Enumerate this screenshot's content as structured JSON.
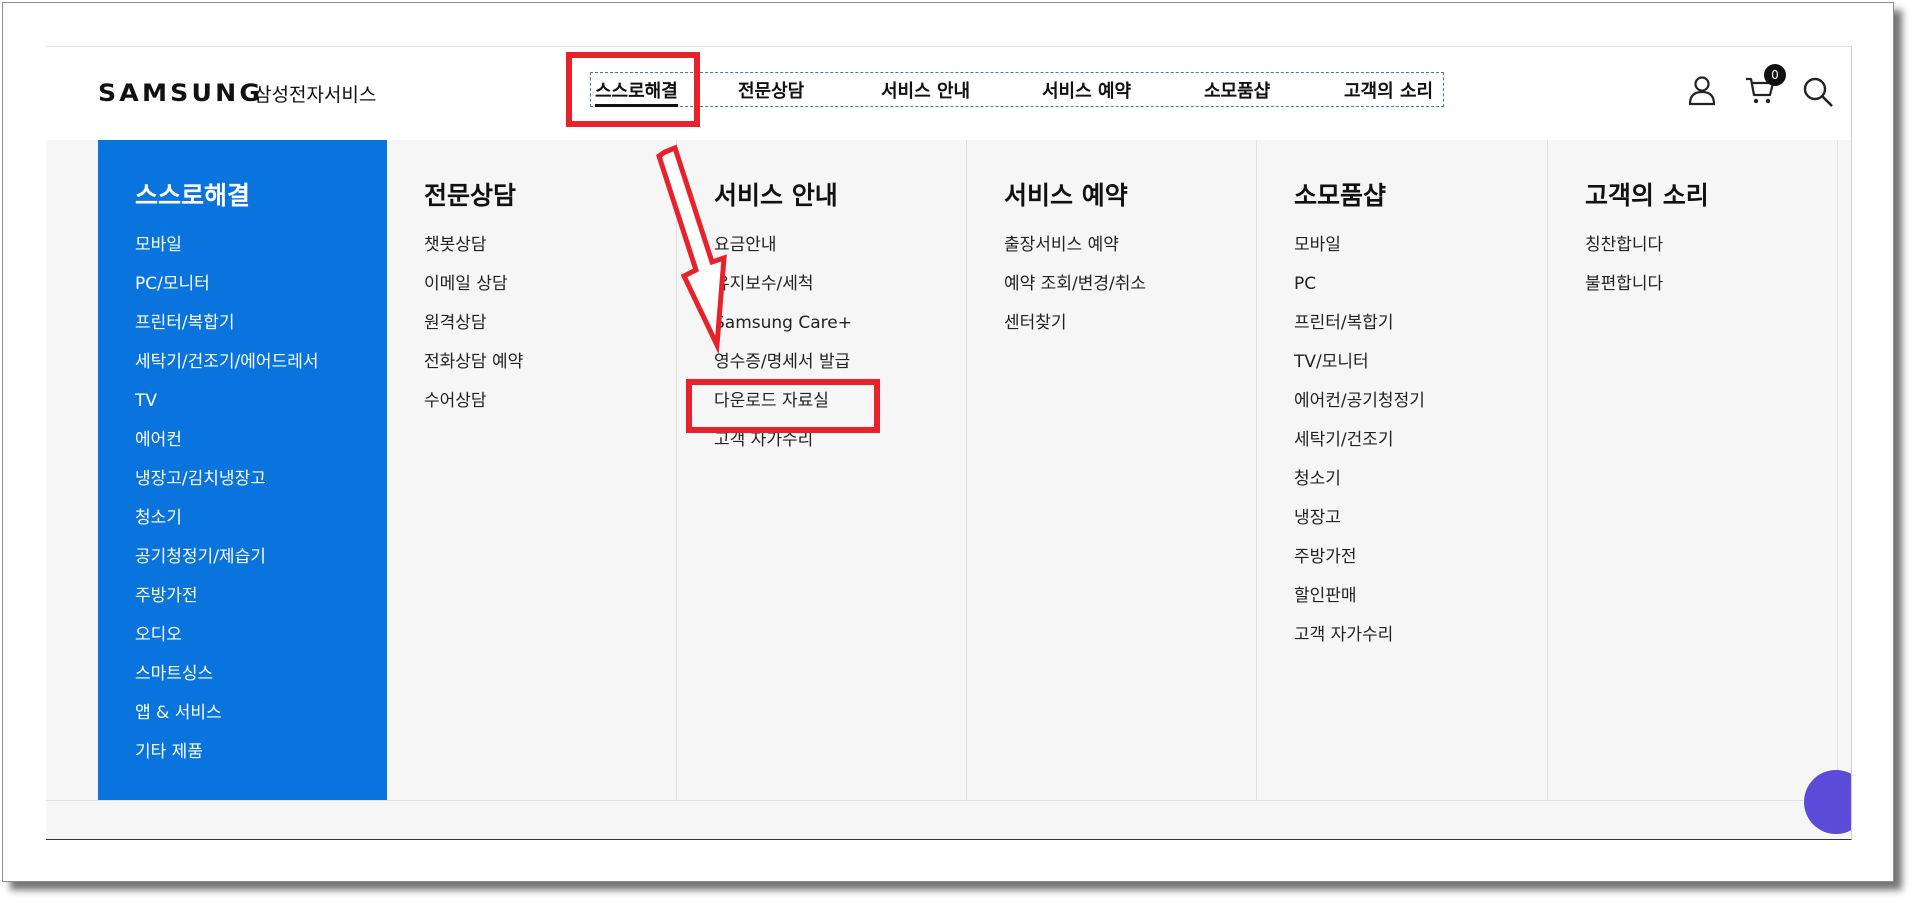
{
  "brand": {
    "logo": "SAMSUNG",
    "subtitle": "삼성전자서비스"
  },
  "nav": {
    "items": [
      {
        "label": "스스로해결"
      },
      {
        "label": "전문상담"
      },
      {
        "label": "서비스 안내"
      },
      {
        "label": "서비스 예약"
      },
      {
        "label": "소모품샵"
      },
      {
        "label": "고객의 소리"
      }
    ],
    "active": "스스로해결"
  },
  "cart": {
    "count": "0"
  },
  "icons": {
    "user": "user-icon",
    "cart": "cart-icon",
    "search": "search-icon"
  },
  "menu": {
    "self_solve": {
      "title": "스스로해결",
      "items": [
        "모바일",
        "PC/모니터",
        "프린터/복합기",
        "세탁기/건조기/에어드레서",
        "TV",
        "에어컨",
        "냉장고/김치냉장고",
        "청소기",
        "공기청정기/제습기",
        "주방가전",
        "오디오",
        "스마트싱스",
        "앱 & 서비스",
        "기타 제품"
      ]
    },
    "consult": {
      "title": "전문상담",
      "items": [
        "챗봇상담",
        "이메일 상담",
        "원격상담",
        "전화상담 예약",
        "수어상담"
      ]
    },
    "service_info": {
      "title": "서비스 안내",
      "items": [
        "요금안내",
        "유지보수/세척",
        "Samsung Care+",
        "영수증/명세서 발급",
        "다운로드 자료실",
        "고객 자가수리"
      ]
    },
    "reservation": {
      "title": "서비스 예약",
      "items": [
        "출장서비스 예약",
        "예약 조회/변경/취소",
        "센터찾기"
      ]
    },
    "shop": {
      "title": "소모품샵",
      "items": [
        "모바일",
        "PC",
        "프린터/복합기",
        "TV/모니터",
        "에어컨/공기청정기",
        "세탁기/건조기",
        "청소기",
        "냉장고",
        "주방가전",
        "할인판매",
        "고객 자가수리"
      ]
    },
    "voice": {
      "title": "고객의 소리",
      "items": [
        "칭찬합니다",
        "불편합니다"
      ]
    }
  },
  "colors": {
    "accent_blue": "#0a74de",
    "annotation_red": "#e8222a",
    "menu_bg": "#f6f6f6"
  }
}
